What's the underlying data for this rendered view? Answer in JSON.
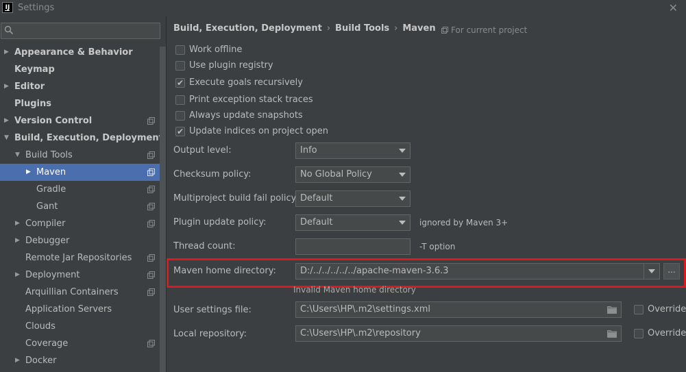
{
  "window": {
    "title": "Settings",
    "app_icon_text": "IJ",
    "close_glyph": "✕"
  },
  "search": {
    "value": "",
    "placeholder": ""
  },
  "sidebar": {
    "items": [
      {
        "label": "Appearance & Behavior",
        "bold": true,
        "arrow": "▶",
        "level": 0,
        "proj": false,
        "selected": false
      },
      {
        "label": "Keymap",
        "bold": true,
        "arrow": "",
        "level": 0,
        "proj": false,
        "selected": false
      },
      {
        "label": "Editor",
        "bold": true,
        "arrow": "▶",
        "level": 0,
        "proj": false,
        "selected": false
      },
      {
        "label": "Plugins",
        "bold": true,
        "arrow": "",
        "level": 0,
        "proj": false,
        "selected": false
      },
      {
        "label": "Version Control",
        "bold": true,
        "arrow": "▶",
        "level": 0,
        "proj": true,
        "selected": false
      },
      {
        "label": "Build, Execution, Deployment",
        "bold": true,
        "arrow": "▼",
        "level": 0,
        "proj": false,
        "selected": false
      },
      {
        "label": "Build Tools",
        "bold": false,
        "arrow": "▼",
        "level": 1,
        "proj": true,
        "selected": false
      },
      {
        "label": "Maven",
        "bold": false,
        "arrow": "▶",
        "level": 2,
        "proj": true,
        "selected": true
      },
      {
        "label": "Gradle",
        "bold": false,
        "arrow": "",
        "level": 2,
        "proj": true,
        "selected": false
      },
      {
        "label": "Gant",
        "bold": false,
        "arrow": "",
        "level": 2,
        "proj": true,
        "selected": false
      },
      {
        "label": "Compiler",
        "bold": false,
        "arrow": "▶",
        "level": 1,
        "proj": true,
        "selected": false
      },
      {
        "label": "Debugger",
        "bold": false,
        "arrow": "▶",
        "level": 1,
        "proj": false,
        "selected": false
      },
      {
        "label": "Remote Jar Repositories",
        "bold": false,
        "arrow": "",
        "level": 1,
        "proj": true,
        "selected": false
      },
      {
        "label": "Deployment",
        "bold": false,
        "arrow": "▶",
        "level": 1,
        "proj": true,
        "selected": false
      },
      {
        "label": "Arquillian Containers",
        "bold": false,
        "arrow": "",
        "level": 1,
        "proj": true,
        "selected": false
      },
      {
        "label": "Application Servers",
        "bold": false,
        "arrow": "",
        "level": 1,
        "proj": false,
        "selected": false
      },
      {
        "label": "Clouds",
        "bold": false,
        "arrow": "",
        "level": 1,
        "proj": false,
        "selected": false
      },
      {
        "label": "Coverage",
        "bold": false,
        "arrow": "",
        "level": 1,
        "proj": true,
        "selected": false
      },
      {
        "label": "Docker",
        "bold": false,
        "arrow": "▶",
        "level": 1,
        "proj": false,
        "selected": false
      }
    ]
  },
  "breadcrumb": {
    "items": [
      "Build, Execution, Deployment",
      "Build Tools",
      "Maven"
    ],
    "separator": "›"
  },
  "scope_label": "For current project",
  "options": [
    {
      "label": "Work offline",
      "checked": false
    },
    {
      "label": "Use plugin registry",
      "checked": false
    },
    {
      "label": "Execute goals recursively",
      "checked": true
    },
    {
      "label": "Print exception stack traces",
      "checked": false
    },
    {
      "label": "Always update snapshots",
      "checked": false
    },
    {
      "label": "Update indices on project open",
      "checked": true
    }
  ],
  "fields": {
    "output_level": {
      "label": "Output level:",
      "value": "Info"
    },
    "checksum_policy": {
      "label": "Checksum policy:",
      "value": "No Global Policy"
    },
    "multiproject_fail": {
      "label": "Multiproject build fail policy:",
      "value": "Default"
    },
    "plugin_update": {
      "label": "Plugin update policy:",
      "value": "Default",
      "hint": "ignored by Maven 3+"
    },
    "thread_count": {
      "label": "Thread count:",
      "value": "",
      "hint": "-T option"
    },
    "maven_home": {
      "label": "Maven home directory:",
      "value": "D:/../../../../../apache-maven-3.6.3",
      "browse": "...",
      "error": "Invalid Maven home directory"
    },
    "user_settings": {
      "label": "User settings file:",
      "value": "C:\\Users\\HP\\.m2\\settings.xml",
      "override_label": "Override",
      "override_checked": false
    },
    "local_repo": {
      "label": "Local repository:",
      "value": "C:\\Users\\HP\\.m2\\repository",
      "override_label": "Override",
      "override_checked": false
    }
  },
  "colors": {
    "background": "#3c3f41",
    "selection": "#4b6eaf",
    "highlight": "#e0181d"
  }
}
